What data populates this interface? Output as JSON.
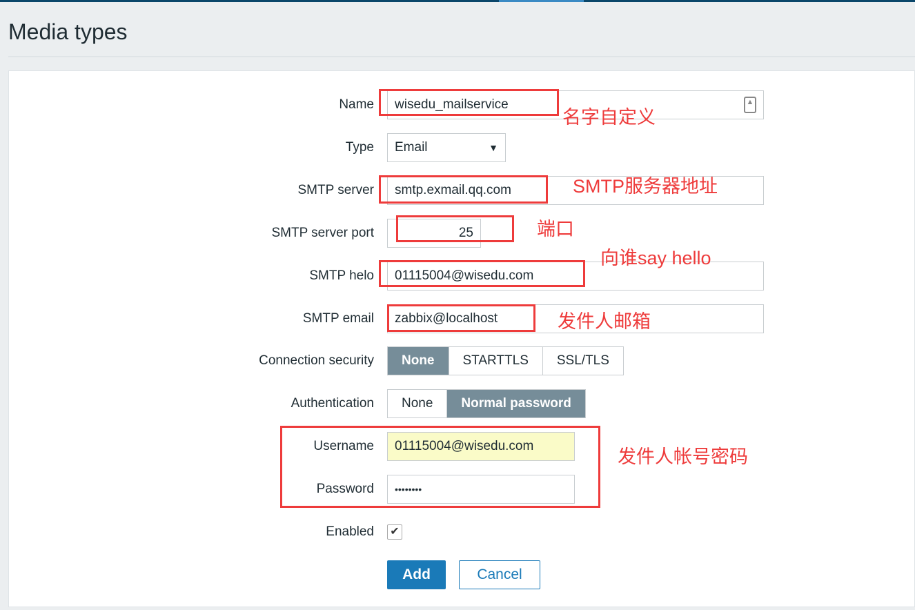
{
  "page": {
    "title": "Media types"
  },
  "form": {
    "name": {
      "label": "Name",
      "value": "wisedu_mailservice"
    },
    "type": {
      "label": "Type",
      "value": "Email"
    },
    "smtp_server": {
      "label": "SMTP server",
      "value": "smtp.exmail.qq.com"
    },
    "smtp_port": {
      "label": "SMTP server port",
      "value": "25"
    },
    "smtp_helo": {
      "label": "SMTP helo",
      "value": "01115004@wisedu.com"
    },
    "smtp_email": {
      "label": "SMTP email",
      "value": "zabbix@localhost"
    },
    "connection_security": {
      "label": "Connection security",
      "options": [
        "None",
        "STARTTLS",
        "SSL/TLS"
      ],
      "selected": "None"
    },
    "authentication": {
      "label": "Authentication",
      "options": [
        "None",
        "Normal password"
      ],
      "selected": "Normal password"
    },
    "username": {
      "label": "Username",
      "value": "01115004@wisedu.com"
    },
    "password": {
      "label": "Password",
      "value": "••••••••"
    },
    "enabled": {
      "label": "Enabled",
      "checked": true
    },
    "add_label": "Add",
    "cancel_label": "Cancel"
  },
  "annotations": {
    "name": "名字自定义",
    "server": "SMTP服务器地址",
    "port": "端口",
    "helo": "向谁say hello",
    "email": "发件人邮箱",
    "account": "发件人帐号密码"
  },
  "colors": {
    "accent": "#1a7ab8",
    "annotation": "#ee3b3b",
    "selected_segment": "#768d99"
  }
}
